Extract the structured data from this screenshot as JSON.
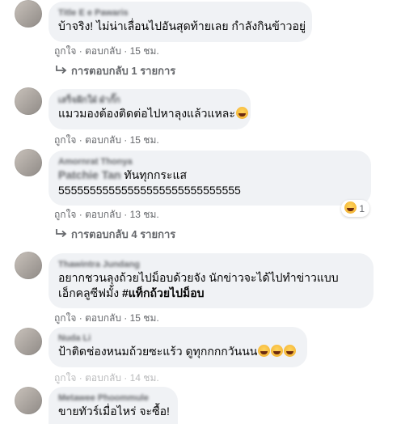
{
  "actions": {
    "like": "ถูกใจ",
    "reply": "ตอบกลับ",
    "sep": " · "
  },
  "comments": [
    {
      "name": "Title E e Pawaris",
      "text": "บ้าจริง! ไม่น่าเลื่อนไปอันสุดท้ายเลย กำลังกินข้าวอยู่",
      "time": "15 ชม."
    },
    {
      "name": "เสร็จฝักใฝ่ ฝ่ากั๊ก",
      "text": "แมวมองต้องติดต่อไปหาลุงแล้วแหละ",
      "time": "15 ชม."
    },
    {
      "name": "Amornrat Thonya",
      "tag": "Patchie Tan",
      "text_line1": " ทันทุกกระแส",
      "text_line2": "55555555555555555555555555555",
      "time": "13 ชม.",
      "reaction_count": "1"
    },
    {
      "name": "Thawintra Jundang",
      "text_line1": "อยากชวนลุงถ้วยไปม็อบด้วยจัง นักข่าวจะได้ไปทำข่าวแบบ",
      "text_line2": "เอ็กคลูซีฟมั้ง ",
      "hashtag": "#แท็กถ้วยไปม็อบ",
      "time": "15 ชม."
    },
    {
      "name": "Nuda Li",
      "text": "ป้าติดช่องหนมถ้วยซะแร้ว ดูทุกกกกวันนน",
      "time": "14 ชม."
    },
    {
      "name": "Metawee Phoommule",
      "text": "ขายทัวร์เมื่อไหร่ จะซื้อ!"
    }
  ],
  "replies": [
    {
      "label": "การตอบกลับ 1 รายการ"
    },
    {
      "label": "การตอบกลับ 4 รายการ"
    }
  ],
  "icons": {
    "reply_arrow": "reply-arrow-icon",
    "emoji": "laughing-emoji"
  },
  "colors": {
    "bubble": "#f0f2f5",
    "secondary_text": "#65676b",
    "primary_text": "#050505"
  }
}
